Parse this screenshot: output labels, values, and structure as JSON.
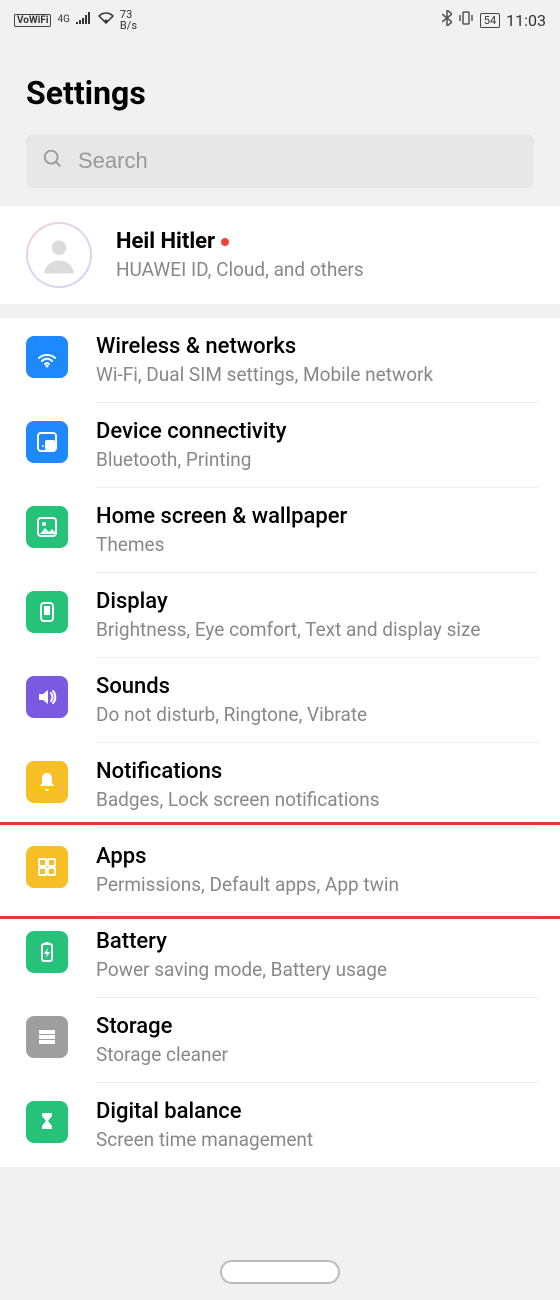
{
  "status": {
    "badge": "VoWiFi",
    "signal_type": "4G",
    "rate_top": "73",
    "rate_bottom": "B/s",
    "battery": "54",
    "time": "11:03"
  },
  "page_title": "Settings",
  "search": {
    "placeholder": "Search"
  },
  "account": {
    "name": "Heil Hitler",
    "sub": "HUAWEI ID, Cloud, and others"
  },
  "items": [
    {
      "title": "Wireless & networks",
      "sub": "Wi-Fi, Dual SIM settings, Mobile network",
      "color": "c-blue",
      "icon": "wifi"
    },
    {
      "title": "Device connectivity",
      "sub": "Bluetooth, Printing",
      "color": "c-blue2",
      "icon": "connect"
    },
    {
      "title": "Home screen & wallpaper",
      "sub": "Themes",
      "color": "c-green",
      "icon": "image"
    },
    {
      "title": "Display",
      "sub": "Brightness, Eye comfort, Text and display size",
      "color": "c-green2",
      "icon": "display"
    },
    {
      "title": "Sounds",
      "sub": "Do not disturb, Ringtone, Vibrate",
      "color": "c-purple",
      "icon": "sound"
    },
    {
      "title": "Notifications",
      "sub": "Badges, Lock screen notifications",
      "color": "c-yellow",
      "icon": "bell"
    },
    {
      "title": "Apps",
      "sub": "Permissions, Default apps, App twin",
      "color": "c-yellow2",
      "icon": "apps"
    },
    {
      "title": "Battery",
      "sub": "Power saving mode, Battery usage",
      "color": "c-green",
      "icon": "battery"
    },
    {
      "title": "Storage",
      "sub": "Storage cleaner",
      "color": "c-grey",
      "icon": "storage"
    },
    {
      "title": "Digital balance",
      "sub": "Screen time management",
      "color": "c-green2",
      "icon": "hourglass"
    }
  ],
  "highlight_index": 6
}
